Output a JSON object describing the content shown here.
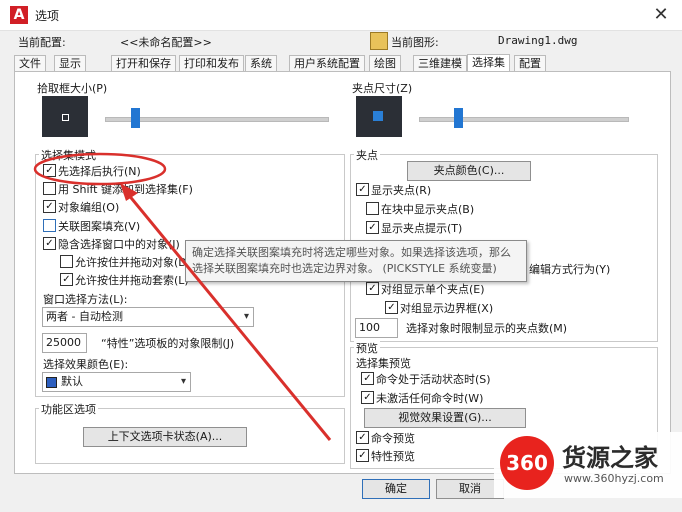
{
  "window": {
    "title": "选项",
    "app_icon": "A",
    "close": "✕"
  },
  "profile": {
    "label": "当前配置:",
    "value": "<<未命名配置>>",
    "drawing_label": "当前图形:",
    "drawing_value": "Drawing1.dwg"
  },
  "tabs": [
    "文件",
    "显示",
    "打开和保存",
    "打印和发布",
    "系统",
    "用户系统配置",
    "绘图",
    "三维建模",
    "选择集",
    "配置"
  ],
  "active_tab": "选择集",
  "pickbox": {
    "label": "拾取框大小(P)"
  },
  "selection_modes": {
    "label": "选择集模式",
    "items": [
      {
        "label": "先选择后执行(N)",
        "checked": true
      },
      {
        "label": "用 Shift 键添加到选择集(F)",
        "checked": false
      },
      {
        "label": "对象编组(O)",
        "checked": true
      },
      {
        "label": "关联图案填充(V)",
        "checked": false
      },
      {
        "label": "隐含选择窗口中的对象(I)",
        "checked": true
      },
      {
        "label": "允许按住并拖动对象(D)",
        "checked": false
      },
      {
        "label": "允许按住并拖动套索(L)",
        "checked": true
      }
    ]
  },
  "window_method": {
    "label": "窗口选择方法(L):",
    "value": "两者 - 自动检测"
  },
  "props_limit": {
    "value": "25000",
    "label": "“特性”选项板的对象限制(J)"
  },
  "effect_color": {
    "label": "选择效果颜色(E):",
    "value": "默认",
    "swatch": "#2d5fbf"
  },
  "ribbon": {
    "label": "功能区选项",
    "button": "上下文选项卡状态(A)..."
  },
  "grip_size": {
    "label": "夹点尺寸(Z)"
  },
  "grips": {
    "label": "夹点",
    "color_button": "夹点颜色(C)...",
    "items": [
      {
        "label": "显示夹点(R)",
        "checked": true
      },
      {
        "label": "在块中显示夹点(B)",
        "checked": false
      },
      {
        "label": "显示夹点提示(T)",
        "checked": true
      }
    ],
    "partial_right_text": "编辑方式行为(Y)",
    "single_grip": "对组显示单个夹点(E)",
    "group_box": {
      "label": "对组显示边界框(X)",
      "checked": true
    },
    "limit_value": "100",
    "limit_label": "选择对象时限制显示的夹点数(M)"
  },
  "preview": {
    "label": "预览",
    "sub_label": "选择集预览",
    "items": [
      {
        "label": "命令处于活动状态时(S)",
        "checked": true
      },
      {
        "label": "未激活任何命令时(W)",
        "checked": true
      }
    ],
    "effects_button": "视觉效果设置(G)...",
    "command_preview": {
      "label": "命令预览",
      "checked": true
    },
    "property_preview": {
      "label": "特性预览",
      "checked": true
    }
  },
  "tooltip": {
    "line1": "确定选择关联图案填充时将选定哪些对象。如果选择该选项，那么",
    "line2": "选择关联图案填充时也选定边界对象。 (PICKSTYLE 系统变量)"
  },
  "buttons": {
    "ok": "确定",
    "cancel": "取消"
  },
  "watermark": {
    "logo": "360",
    "name": "货源之家",
    "url": "www.360hyzj.com"
  },
  "colors": {
    "annotation": "#d9302c",
    "slider_thumb": "#2276d2",
    "grip_marker": "#2a7fd6"
  }
}
